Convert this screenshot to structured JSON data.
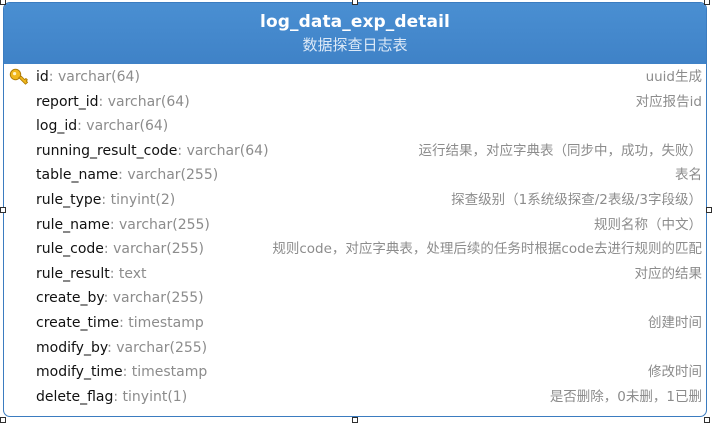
{
  "entity": {
    "name": "log_data_exp_detail",
    "comment": "数据探查日志表",
    "accent_color": "#4a8fd2",
    "fields": [
      {
        "name": "id",
        "type": ": varchar(64)",
        "comment": "uuid生成",
        "primary_key": true,
        "icon": "key-icon"
      },
      {
        "name": "report_id",
        "type": ": varchar(64)",
        "comment": "对应报告id",
        "primary_key": false
      },
      {
        "name": "log_id",
        "type": ": varchar(64)",
        "comment": "",
        "primary_key": false
      },
      {
        "name": "running_result_code",
        "type": ": varchar(64)",
        "comment": "运行结果，对应字典表（同步中，成功，失败）",
        "primary_key": false
      },
      {
        "name": "table_name",
        "type": ": varchar(255)",
        "comment": "表名",
        "primary_key": false
      },
      {
        "name": "rule_type",
        "type": ": tinyint(2)",
        "comment": "探查级别（1系统级探查/2表级/3字段级）",
        "primary_key": false
      },
      {
        "name": "rule_name",
        "type": ": varchar(255)",
        "comment": "规则名称（中文）",
        "primary_key": false
      },
      {
        "name": "rule_code",
        "type": ": varchar(255)",
        "comment": "规则code，对应字典表，处理后续的任务时根据code去进行规则的匹配",
        "primary_key": false
      },
      {
        "name": "rule_result",
        "type": ": text",
        "comment": "对应的结果",
        "primary_key": false
      },
      {
        "name": "create_by",
        "type": ": varchar(255)",
        "comment": "",
        "primary_key": false
      },
      {
        "name": "create_time",
        "type": ": timestamp",
        "comment": "创建时间",
        "primary_key": false
      },
      {
        "name": "modify_by",
        "type": ": varchar(255)",
        "comment": "",
        "primary_key": false
      },
      {
        "name": "modify_time",
        "type": ": timestamp",
        "comment": "修改时间",
        "primary_key": false
      },
      {
        "name": "delete_flag",
        "type": ": tinyint(1)",
        "comment": "是否删除，0未删，1已删",
        "primary_key": false
      }
    ]
  }
}
